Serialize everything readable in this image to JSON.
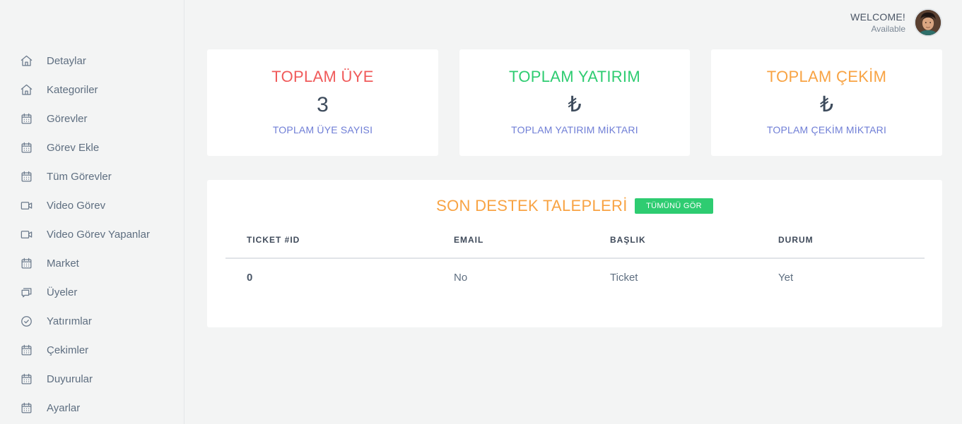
{
  "header": {
    "welcome": "WELCOME!",
    "status": "Available"
  },
  "sidebar": {
    "items": [
      {
        "label": "Detaylar",
        "icon": "home-icon"
      },
      {
        "label": "Kategoriler",
        "icon": "home-icon"
      },
      {
        "label": "Görevler",
        "icon": "calendar-icon"
      },
      {
        "label": "Görev Ekle",
        "icon": "calendar-icon"
      },
      {
        "label": "Tüm Görevler",
        "icon": "calendar-icon"
      },
      {
        "label": "Video Görev",
        "icon": "video-icon"
      },
      {
        "label": "Video Görev Yapanlar",
        "icon": "video-icon"
      },
      {
        "label": "Market",
        "icon": "calendar-icon"
      },
      {
        "label": "Üyeler",
        "icon": "chat-icon"
      },
      {
        "label": "Yatırımlar",
        "icon": "check-circle-icon"
      },
      {
        "label": "Çekimler",
        "icon": "calendar-icon"
      },
      {
        "label": "Duyurular",
        "icon": "calendar-icon"
      },
      {
        "label": "Ayarlar",
        "icon": "calendar-icon"
      }
    ]
  },
  "stats": [
    {
      "title": "TOPLAM ÜYE",
      "value": "3",
      "subtitle": "TOPLAM ÜYE SAYISI",
      "color": "#f05a5a"
    },
    {
      "title": "TOPLAM YATIRIM",
      "value": "₺",
      "subtitle": "TOPLAM YATIRIM MİKTARI",
      "color": "#2ecc71"
    },
    {
      "title": "TOPLAM ÇEKİM",
      "value": "₺",
      "subtitle": "TOPLAM ÇEKİM MİKTARI",
      "color": "#f8a343"
    }
  ],
  "tickets": {
    "title": "SON DESTEK TALEPLERİ",
    "title_color": "#f8a343",
    "view_all": "TÜMÜNÜ GÖR",
    "view_all_color": "#2ecc71",
    "columns": [
      "TICKET #ID",
      "EMAIL",
      "BAŞLIK",
      "DURUM"
    ],
    "rows": [
      [
        "0",
        "No",
        "Ticket",
        "Yet"
      ]
    ]
  }
}
